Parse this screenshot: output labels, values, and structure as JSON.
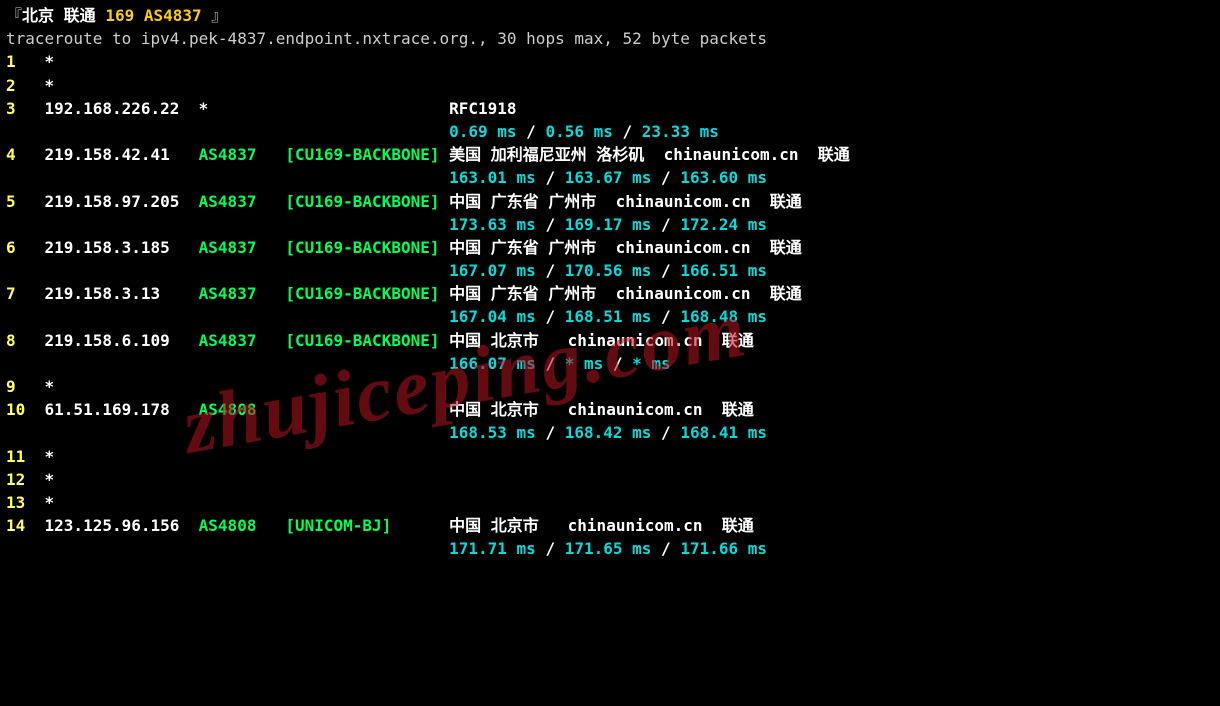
{
  "header": {
    "open_bracket": "『",
    "city": "北京",
    "isp": "联通",
    "asn_num": "169",
    "asn_label": "AS4837",
    "close_bracket": " 』"
  },
  "cmd": "traceroute to ipv4.pek-4837.endpoint.nxtrace.org., 30 hops max, 52 byte packets",
  "watermark": "zhujiceping.com",
  "hops": [
    {
      "n": "1",
      "ip": "*"
    },
    {
      "n": "2",
      "ip": "*"
    },
    {
      "n": "3",
      "ip": "192.168.226.22",
      "asn": "*",
      "netname": "",
      "loc": "RFC1918",
      "rtt": [
        "0.69 ms",
        "0.56 ms",
        "23.33 ms"
      ]
    },
    {
      "n": "4",
      "ip": "219.158.42.41",
      "asn": "AS4837",
      "netname": "[CU169-BACKBONE]",
      "loc": "美国 加利福尼亚州 洛杉矶  chinaunicom.cn  联通",
      "rtt": [
        "163.01 ms",
        "163.67 ms",
        "163.60 ms"
      ]
    },
    {
      "n": "5",
      "ip": "219.158.97.205",
      "asn": "AS4837",
      "netname": "[CU169-BACKBONE]",
      "loc": "中国 广东省 广州市  chinaunicom.cn  联通",
      "rtt": [
        "173.63 ms",
        "169.17 ms",
        "172.24 ms"
      ]
    },
    {
      "n": "6",
      "ip": "219.158.3.185",
      "asn": "AS4837",
      "netname": "[CU169-BACKBONE]",
      "loc": "中国 广东省 广州市  chinaunicom.cn  联通",
      "rtt": [
        "167.07 ms",
        "170.56 ms",
        "166.51 ms"
      ]
    },
    {
      "n": "7",
      "ip": "219.158.3.13",
      "asn": "AS4837",
      "netname": "[CU169-BACKBONE]",
      "loc": "中国 广东省 广州市  chinaunicom.cn  联通",
      "rtt": [
        "167.04 ms",
        "168.51 ms",
        "168.48 ms"
      ]
    },
    {
      "n": "8",
      "ip": "219.158.6.109",
      "asn": "AS4837",
      "netname": "[CU169-BACKBONE]",
      "loc": "中国 北京市   chinaunicom.cn  联通",
      "rtt": [
        "166.07 ms",
        "* ms",
        "* ms"
      ]
    },
    {
      "n": "9",
      "ip": "*"
    },
    {
      "n": "10",
      "ip": "61.51.169.178",
      "asn": "AS4808",
      "netname": "",
      "loc": "中国 北京市   chinaunicom.cn  联通",
      "rtt": [
        "168.53 ms",
        "168.42 ms",
        "168.41 ms"
      ]
    },
    {
      "n": "11",
      "ip": "*"
    },
    {
      "n": "12",
      "ip": "*"
    },
    {
      "n": "13",
      "ip": "*"
    },
    {
      "n": "14",
      "ip": "123.125.96.156",
      "asn": "AS4808",
      "netname": "[UNICOM-BJ]",
      "loc": "中国 北京市   chinaunicom.cn  联通",
      "rtt": [
        "171.71 ms",
        "171.65 ms",
        "171.66 ms"
      ]
    }
  ]
}
